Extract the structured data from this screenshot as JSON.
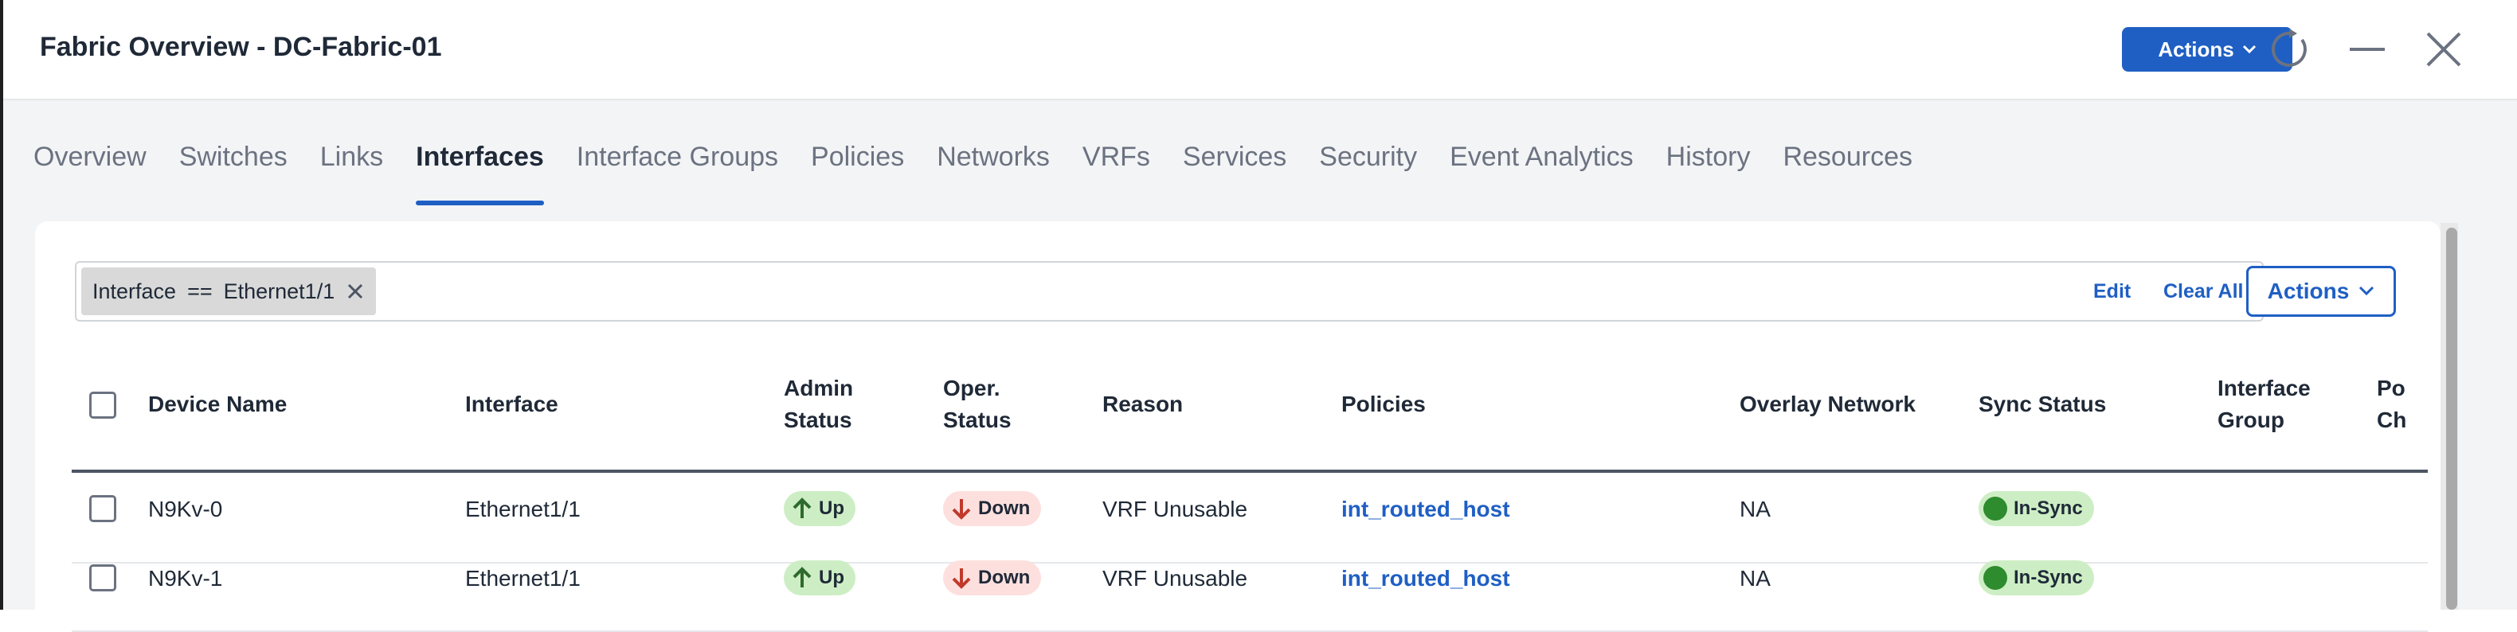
{
  "window": {
    "title": "Fabric Overview - DC-Fabric-01",
    "actions_label": "Actions",
    "refresh_icon": "refresh-icon",
    "minimize_icon": "minimize-icon",
    "close_icon": "close-icon"
  },
  "tabs": [
    {
      "label": "Overview",
      "active": false
    },
    {
      "label": "Switches",
      "active": false
    },
    {
      "label": "Links",
      "active": false
    },
    {
      "label": "Interfaces",
      "active": true
    },
    {
      "label": "Interface Groups",
      "active": false
    },
    {
      "label": "Policies",
      "active": false
    },
    {
      "label": "Networks",
      "active": false
    },
    {
      "label": "VRFs",
      "active": false
    },
    {
      "label": "Services",
      "active": false
    },
    {
      "label": "Security",
      "active": false
    },
    {
      "label": "Event Analytics",
      "active": false
    },
    {
      "label": "History",
      "active": false
    },
    {
      "label": "Resources",
      "active": false
    }
  ],
  "filter": {
    "chip_field": "Interface",
    "chip_operator": "==",
    "chip_value": "Ethernet1/1",
    "edit_label": "Edit",
    "clear_all_label": "Clear All",
    "actions_label": "Actions"
  },
  "table": {
    "columns": {
      "device_name": "Device Name",
      "interface": "Interface",
      "admin_status_1": "Admin",
      "admin_status_2": "Status",
      "oper_status_1": "Oper.",
      "oper_status_2": "Status",
      "reason": "Reason",
      "policies": "Policies",
      "overlay_network": "Overlay Network",
      "sync_status": "Sync Status",
      "interface_group_1": "Interface",
      "interface_group_2": "Group",
      "port_channel_1": "Po",
      "port_channel_2": "Ch"
    },
    "rows": [
      {
        "device": "N9Kv-0",
        "interface": "Ethernet1/1",
        "admin": "Up",
        "oper": "Down",
        "reason": "VRF Unusable",
        "policy": "int_routed_host",
        "overlay": "NA",
        "sync": "In-Sync"
      },
      {
        "device": "N9Kv-1",
        "interface": "Ethernet1/1",
        "admin": "Up",
        "oper": "Down",
        "reason": "VRF Unusable",
        "policy": "int_routed_host",
        "overlay": "NA",
        "sync": "In-Sync"
      }
    ]
  },
  "colors": {
    "accent": "#1f5fc4",
    "up_bg": "#cdeec4",
    "down_bg": "#fde0de",
    "sync_dot": "#2e8b2e"
  }
}
